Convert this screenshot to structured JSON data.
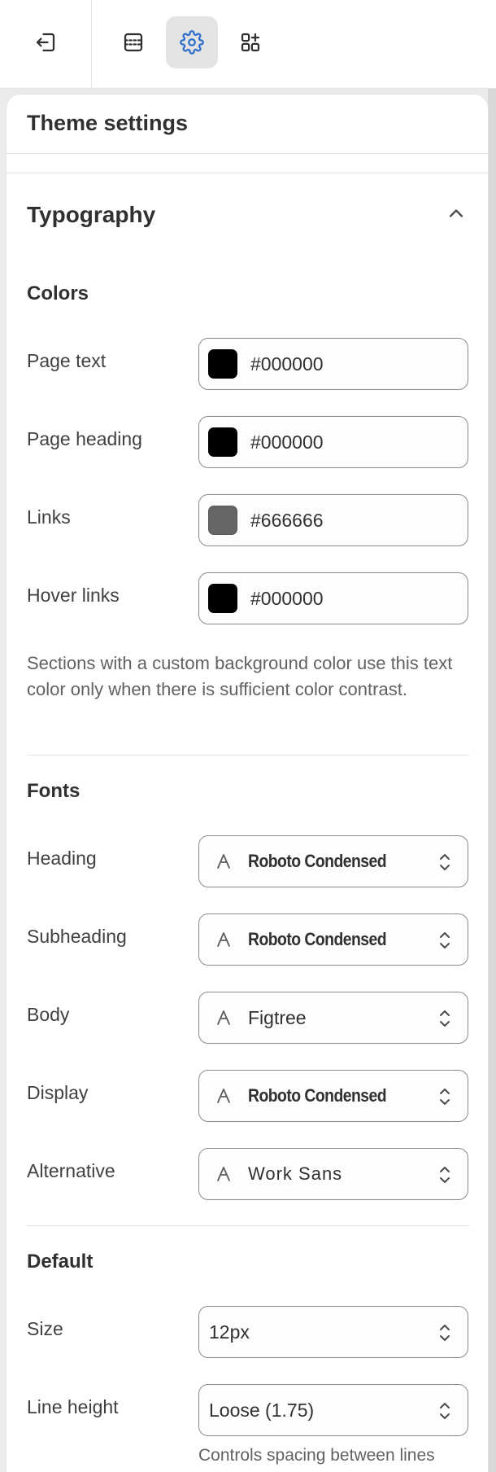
{
  "toolbar": {
    "buttons": [
      {
        "icon": "exit-icon"
      },
      {
        "icon": "sections-icon"
      },
      {
        "icon": "gear-icon",
        "active": true
      },
      {
        "icon": "apps-icon"
      }
    ],
    "accent_color": "#2c6ecb"
  },
  "panel": {
    "title": "Theme settings",
    "section": {
      "title": "Typography",
      "expanded": true
    },
    "colors": {
      "title": "Colors",
      "rows": [
        {
          "label": "Page text",
          "value": "#000000",
          "swatch": "#000000"
        },
        {
          "label": "Page heading",
          "value": "#000000",
          "swatch": "#000000"
        },
        {
          "label": "Links",
          "value": "#666666",
          "swatch": "#666666"
        },
        {
          "label": "Hover links",
          "value": "#000000",
          "swatch": "#000000"
        }
      ],
      "help": "Sections with a custom background color use this text color only when there is sufficient color contrast."
    },
    "fonts": {
      "title": "Fonts",
      "rows": [
        {
          "label": "Heading",
          "value": "Roboto Condensed"
        },
        {
          "label": "Subheading",
          "value": "Roboto Condensed"
        },
        {
          "label": "Body",
          "value": "Figtree"
        },
        {
          "label": "Display",
          "value": "Roboto Condensed"
        },
        {
          "label": "Alternative",
          "value": "Work Sans"
        }
      ]
    },
    "default": {
      "title": "Default",
      "size": {
        "label": "Size",
        "value": "12px"
      },
      "line_height": {
        "label": "Line height",
        "value": "Loose (1.75)",
        "help": "Controls spacing between lines"
      }
    }
  }
}
